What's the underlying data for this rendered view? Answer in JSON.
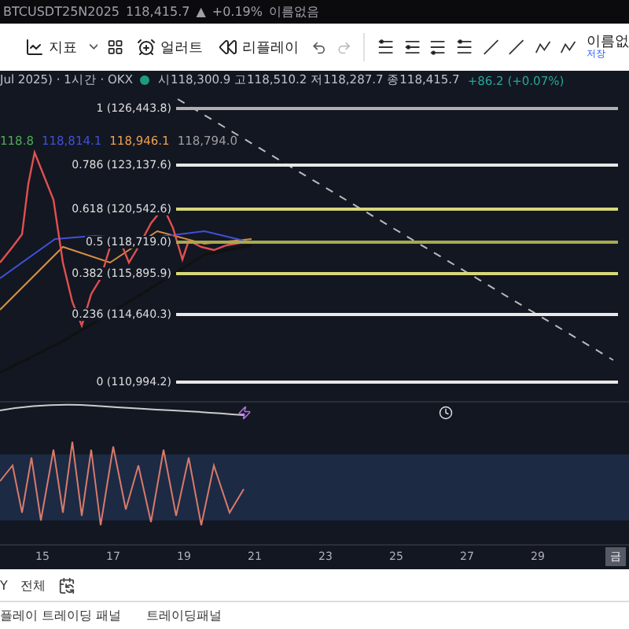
{
  "ticker_bar": {
    "symbol": "BTCUSDT25N2025",
    "price": "118,415.7",
    "arrow": "▲",
    "change": "+0.19%",
    "layout_name": "이름없음"
  },
  "toolbar": {
    "indicators": "지표",
    "alerts": "얼러트",
    "replay": "리플레이",
    "layout_name": "이름없",
    "save": "저장"
  },
  "legend": {
    "title": "Jul 2025) · 1시간 · OKX",
    "ohlc": "시118,300.9 고118,510.2 저118,287.7 종118,415.7",
    "change": "+86.2 (+0.07%)"
  },
  "ma_values": [
    {
      "text": "118.8",
      "color": "#4caf50"
    },
    {
      "text": "118,814.1",
      "color": "#3f51d8"
    },
    {
      "text": "118,946.1",
      "color": "#f0a050"
    },
    {
      "text": "118,794.0",
      "color": "#9e9e9e"
    }
  ],
  "fib_levels": [
    {
      "label": "1 (126,443.8)",
      "color": "#b0b0b0"
    },
    {
      "label": "0.786 (123,137.6)",
      "color": "#e8e8e8"
    },
    {
      "label": "0.618 (120,542.6)",
      "color": "#d8d87a"
    },
    {
      "label": "0.5 (118,719.0)",
      "color": "#a8a850"
    },
    {
      "label": "0.382 (115,895.9)",
      "color": "#d8d87a"
    },
    {
      "label": "0.236 (114,640.3)",
      "color": "#e8e8e8"
    },
    {
      "label": "0 (110,994.2)",
      "color": "#e8e8e8"
    }
  ],
  "x_axis": [
    "15",
    "17",
    "19",
    "21",
    "23",
    "25",
    "27",
    "29"
  ],
  "axis_corner": "금",
  "range_bar": {
    "range": "Y",
    "all": "전체"
  },
  "panel_tabs": [
    "플레이 트레이딩 패널",
    "트레이딩패널"
  ]
}
